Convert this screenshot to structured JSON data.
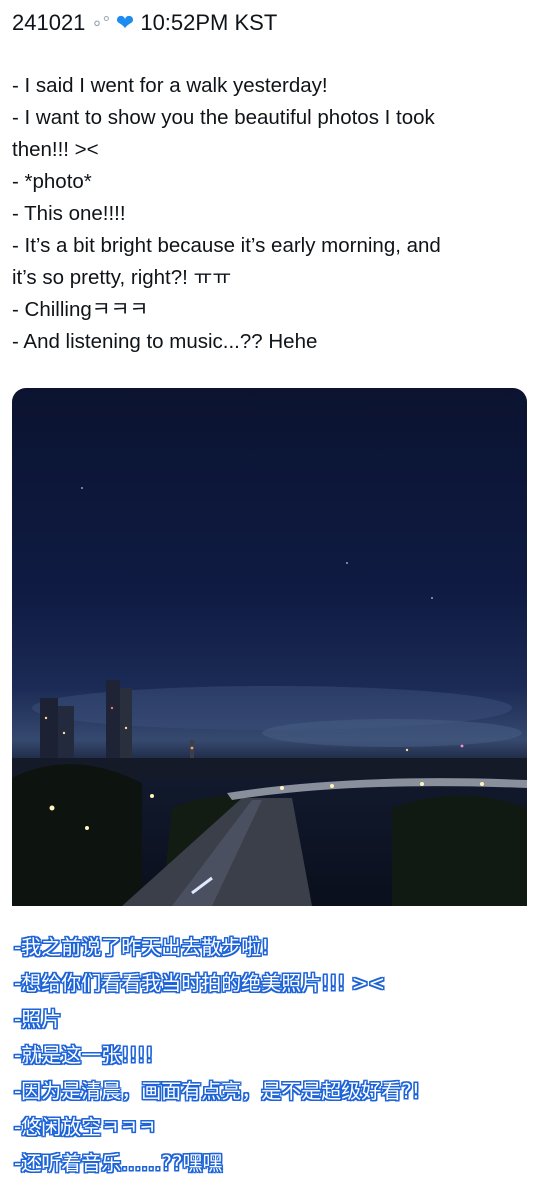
{
  "header": {
    "date": "241021",
    "time": "10:52PM KST",
    "emoji_1": "bubbles-emoji",
    "emoji_2": "blue-heart-emoji"
  },
  "english_lines": [
    "- I said I went for a walk yesterday!",
    "- I want to show you the beautiful photos I took",
    "then!!! ><",
    "- *photo*",
    "- This one!!!!",
    "- It’s a bit bright because it’s early morning, and",
    "it’s so pretty, right?! ㅠㅠ",
    "- Chillingㅋㅋㅋ",
    "- And listening to music...?? Hehe"
  ],
  "chinese_lines": [
    "-我之前说了昨天出去散步啦!",
    "-想给你们看看我当时拍的绝美照片!!! ><",
    "-照片",
    "-就是这一张!!!!",
    "-因为是清晨，画面有点亮，是不是超级好看?!",
    "-悠闲放空ㅋㅋㅋ",
    "-还听着音乐……??嘿嘿"
  ],
  "colors": {
    "heart": "#1d8cf0",
    "chinese_outline": "#1d63d8",
    "night_sky": "#0f1b43"
  }
}
